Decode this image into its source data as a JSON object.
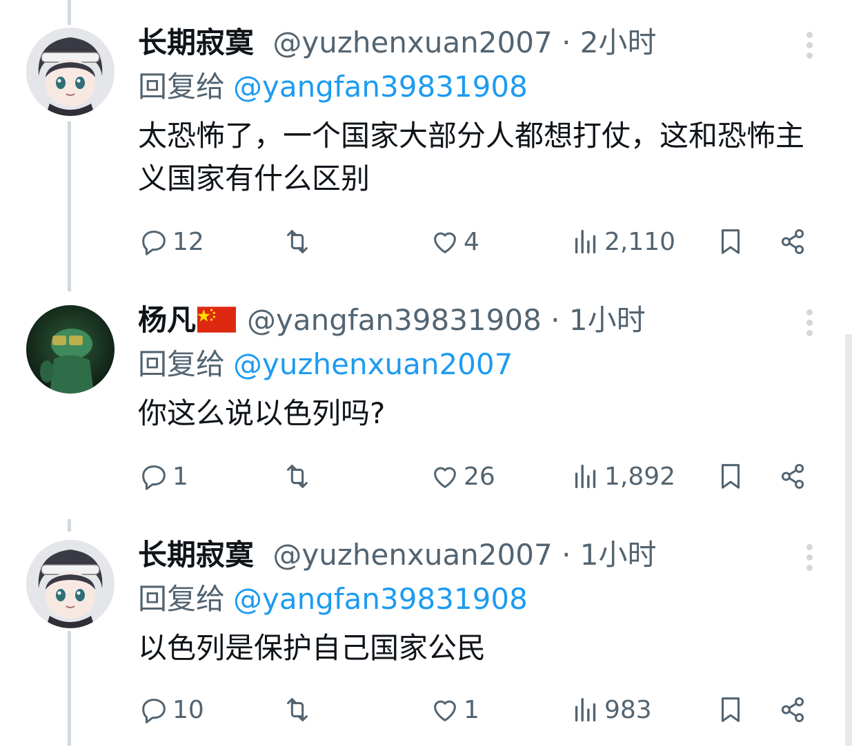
{
  "tweets": [
    {
      "author_name": "长期寂寞",
      "handle": "@yuzhenxuan2007",
      "separator": "·",
      "time": "2小时",
      "reply_prefix": "回复给",
      "reply_to": "@yangfan39831908",
      "text": "太恐怖了，一个国家大部分人都想打仗，这和恐怖主义国家有什么区别",
      "counts": {
        "replies": "12",
        "retweets": "",
        "likes": "4",
        "views": "2,110"
      }
    },
    {
      "author_name": "杨凡",
      "author_flag": "china-flag-emoji",
      "handle": "@yangfan39831908",
      "separator": "·",
      "time": "1小时",
      "reply_prefix": "回复给",
      "reply_to": "@yuzhenxuan2007",
      "text": "你这么说以色列吗?",
      "counts": {
        "replies": "1",
        "retweets": "",
        "likes": "26",
        "views": "1,892"
      }
    },
    {
      "author_name": "长期寂寞",
      "handle": "@yuzhenxuan2007",
      "separator": "·",
      "time": "1小时",
      "reply_prefix": "回复给",
      "reply_to": "@yangfan39831908",
      "text": "以色列是保护自己国家公民",
      "counts": {
        "replies": "10",
        "retweets": "",
        "likes": "1",
        "views": "983"
      }
    }
  ],
  "colors": {
    "text": "#0f1419",
    "secondary": "#536471",
    "link": "#1d9bf0",
    "thread_line": "#cfd9de"
  },
  "icons": [
    "reply-icon",
    "retweet-icon",
    "like-icon",
    "views-icon",
    "bookmark-icon",
    "share-icon",
    "more-options-icon"
  ]
}
